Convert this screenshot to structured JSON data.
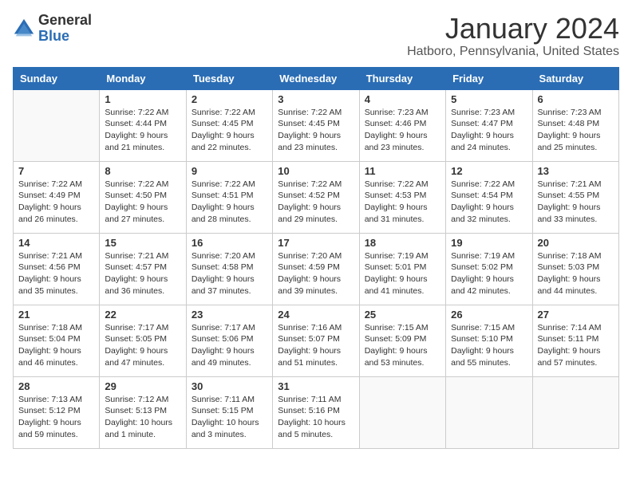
{
  "logo": {
    "general": "General",
    "blue": "Blue"
  },
  "title": "January 2024",
  "subtitle": "Hatboro, Pennsylvania, United States",
  "days_of_week": [
    "Sunday",
    "Monday",
    "Tuesday",
    "Wednesday",
    "Thursday",
    "Friday",
    "Saturday"
  ],
  "weeks": [
    [
      {
        "day": "",
        "sunrise": "",
        "sunset": "",
        "daylight": "",
        "empty": true
      },
      {
        "day": "1",
        "sunrise": "Sunrise: 7:22 AM",
        "sunset": "Sunset: 4:44 PM",
        "daylight": "Daylight: 9 hours and 21 minutes.",
        "empty": false
      },
      {
        "day": "2",
        "sunrise": "Sunrise: 7:22 AM",
        "sunset": "Sunset: 4:45 PM",
        "daylight": "Daylight: 9 hours and 22 minutes.",
        "empty": false
      },
      {
        "day": "3",
        "sunrise": "Sunrise: 7:22 AM",
        "sunset": "Sunset: 4:45 PM",
        "daylight": "Daylight: 9 hours and 23 minutes.",
        "empty": false
      },
      {
        "day": "4",
        "sunrise": "Sunrise: 7:23 AM",
        "sunset": "Sunset: 4:46 PM",
        "daylight": "Daylight: 9 hours and 23 minutes.",
        "empty": false
      },
      {
        "day": "5",
        "sunrise": "Sunrise: 7:23 AM",
        "sunset": "Sunset: 4:47 PM",
        "daylight": "Daylight: 9 hours and 24 minutes.",
        "empty": false
      },
      {
        "day": "6",
        "sunrise": "Sunrise: 7:23 AM",
        "sunset": "Sunset: 4:48 PM",
        "daylight": "Daylight: 9 hours and 25 minutes.",
        "empty": false
      }
    ],
    [
      {
        "day": "7",
        "sunrise": "Sunrise: 7:22 AM",
        "sunset": "Sunset: 4:49 PM",
        "daylight": "Daylight: 9 hours and 26 minutes.",
        "empty": false
      },
      {
        "day": "8",
        "sunrise": "Sunrise: 7:22 AM",
        "sunset": "Sunset: 4:50 PM",
        "daylight": "Daylight: 9 hours and 27 minutes.",
        "empty": false
      },
      {
        "day": "9",
        "sunrise": "Sunrise: 7:22 AM",
        "sunset": "Sunset: 4:51 PM",
        "daylight": "Daylight: 9 hours and 28 minutes.",
        "empty": false
      },
      {
        "day": "10",
        "sunrise": "Sunrise: 7:22 AM",
        "sunset": "Sunset: 4:52 PM",
        "daylight": "Daylight: 9 hours and 29 minutes.",
        "empty": false
      },
      {
        "day": "11",
        "sunrise": "Sunrise: 7:22 AM",
        "sunset": "Sunset: 4:53 PM",
        "daylight": "Daylight: 9 hours and 31 minutes.",
        "empty": false
      },
      {
        "day": "12",
        "sunrise": "Sunrise: 7:22 AM",
        "sunset": "Sunset: 4:54 PM",
        "daylight": "Daylight: 9 hours and 32 minutes.",
        "empty": false
      },
      {
        "day": "13",
        "sunrise": "Sunrise: 7:21 AM",
        "sunset": "Sunset: 4:55 PM",
        "daylight": "Daylight: 9 hours and 33 minutes.",
        "empty": false
      }
    ],
    [
      {
        "day": "14",
        "sunrise": "Sunrise: 7:21 AM",
        "sunset": "Sunset: 4:56 PM",
        "daylight": "Daylight: 9 hours and 35 minutes.",
        "empty": false
      },
      {
        "day": "15",
        "sunrise": "Sunrise: 7:21 AM",
        "sunset": "Sunset: 4:57 PM",
        "daylight": "Daylight: 9 hours and 36 minutes.",
        "empty": false
      },
      {
        "day": "16",
        "sunrise": "Sunrise: 7:20 AM",
        "sunset": "Sunset: 4:58 PM",
        "daylight": "Daylight: 9 hours and 37 minutes.",
        "empty": false
      },
      {
        "day": "17",
        "sunrise": "Sunrise: 7:20 AM",
        "sunset": "Sunset: 4:59 PM",
        "daylight": "Daylight: 9 hours and 39 minutes.",
        "empty": false
      },
      {
        "day": "18",
        "sunrise": "Sunrise: 7:19 AM",
        "sunset": "Sunset: 5:01 PM",
        "daylight": "Daylight: 9 hours and 41 minutes.",
        "empty": false
      },
      {
        "day": "19",
        "sunrise": "Sunrise: 7:19 AM",
        "sunset": "Sunset: 5:02 PM",
        "daylight": "Daylight: 9 hours and 42 minutes.",
        "empty": false
      },
      {
        "day": "20",
        "sunrise": "Sunrise: 7:18 AM",
        "sunset": "Sunset: 5:03 PM",
        "daylight": "Daylight: 9 hours and 44 minutes.",
        "empty": false
      }
    ],
    [
      {
        "day": "21",
        "sunrise": "Sunrise: 7:18 AM",
        "sunset": "Sunset: 5:04 PM",
        "daylight": "Daylight: 9 hours and 46 minutes.",
        "empty": false
      },
      {
        "day": "22",
        "sunrise": "Sunrise: 7:17 AM",
        "sunset": "Sunset: 5:05 PM",
        "daylight": "Daylight: 9 hours and 47 minutes.",
        "empty": false
      },
      {
        "day": "23",
        "sunrise": "Sunrise: 7:17 AM",
        "sunset": "Sunset: 5:06 PM",
        "daylight": "Daylight: 9 hours and 49 minutes.",
        "empty": false
      },
      {
        "day": "24",
        "sunrise": "Sunrise: 7:16 AM",
        "sunset": "Sunset: 5:07 PM",
        "daylight": "Daylight: 9 hours and 51 minutes.",
        "empty": false
      },
      {
        "day": "25",
        "sunrise": "Sunrise: 7:15 AM",
        "sunset": "Sunset: 5:09 PM",
        "daylight": "Daylight: 9 hours and 53 minutes.",
        "empty": false
      },
      {
        "day": "26",
        "sunrise": "Sunrise: 7:15 AM",
        "sunset": "Sunset: 5:10 PM",
        "daylight": "Daylight: 9 hours and 55 minutes.",
        "empty": false
      },
      {
        "day": "27",
        "sunrise": "Sunrise: 7:14 AM",
        "sunset": "Sunset: 5:11 PM",
        "daylight": "Daylight: 9 hours and 57 minutes.",
        "empty": false
      }
    ],
    [
      {
        "day": "28",
        "sunrise": "Sunrise: 7:13 AM",
        "sunset": "Sunset: 5:12 PM",
        "daylight": "Daylight: 9 hours and 59 minutes.",
        "empty": false
      },
      {
        "day": "29",
        "sunrise": "Sunrise: 7:12 AM",
        "sunset": "Sunset: 5:13 PM",
        "daylight": "Daylight: 10 hours and 1 minute.",
        "empty": false
      },
      {
        "day": "30",
        "sunrise": "Sunrise: 7:11 AM",
        "sunset": "Sunset: 5:15 PM",
        "daylight": "Daylight: 10 hours and 3 minutes.",
        "empty": false
      },
      {
        "day": "31",
        "sunrise": "Sunrise: 7:11 AM",
        "sunset": "Sunset: 5:16 PM",
        "daylight": "Daylight: 10 hours and 5 minutes.",
        "empty": false
      },
      {
        "day": "",
        "sunrise": "",
        "sunset": "",
        "daylight": "",
        "empty": true
      },
      {
        "day": "",
        "sunrise": "",
        "sunset": "",
        "daylight": "",
        "empty": true
      },
      {
        "day": "",
        "sunrise": "",
        "sunset": "",
        "daylight": "",
        "empty": true
      }
    ]
  ]
}
